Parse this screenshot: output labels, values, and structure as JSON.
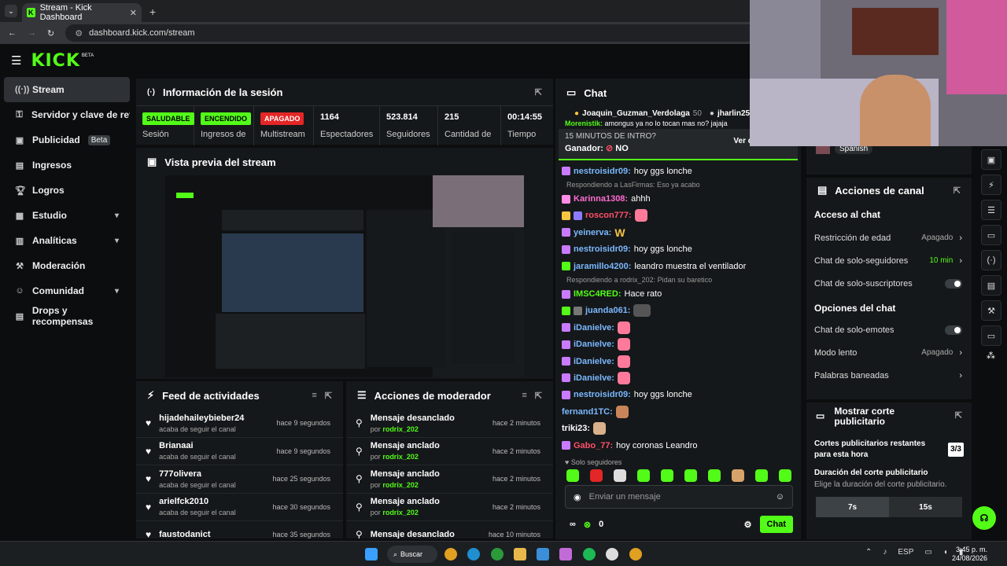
{
  "browser": {
    "tab_title": "Stream - Kick Dashboard",
    "url": "dashboard.kick.com/stream"
  },
  "brand": {
    "logo": "KICK",
    "tag": "BETA",
    "accent": "#53fc18"
  },
  "sidebar": {
    "items": [
      {
        "label": "Stream",
        "icon": "stream-icon"
      },
      {
        "label": "Servidor y clave de retransmisión",
        "icon": "key-icon"
      },
      {
        "label": "Publicidad",
        "badge": "Beta",
        "icon": "ad-icon"
      },
      {
        "label": "Ingresos",
        "icon": "revenue-icon"
      },
      {
        "label": "Logros",
        "icon": "trophy-icon"
      },
      {
        "label": "Estudio",
        "icon": "studio-icon"
      },
      {
        "label": "Analíticas",
        "icon": "chart-icon"
      },
      {
        "label": "Moderación",
        "icon": "hammer-icon"
      },
      {
        "label": "Comunidad",
        "icon": "community-icon"
      },
      {
        "label": "Drops y recompensas",
        "icon": "gift-icon"
      }
    ]
  },
  "session": {
    "title": "Información de la sesión",
    "stats": [
      {
        "pill": "SALUDABLE",
        "label": "Sesión"
      },
      {
        "pill": "ENCENDIDO",
        "label": "Ingresos de"
      },
      {
        "pill": "APAGADO",
        "label": "Multistream"
      },
      {
        "value": "1164",
        "label": "Espectadores"
      },
      {
        "value": "523.814",
        "label": "Seguidores"
      },
      {
        "value": "215",
        "label": "Cantidad de"
      },
      {
        "value": "00:14:55",
        "label": "Tiempo"
      }
    ]
  },
  "preview": {
    "title": "Vista previa del stream"
  },
  "feed": {
    "title": "Feed de actividades",
    "rows": [
      {
        "name": "hijadehaileybieber24",
        "sub": "acaba de seguir el canal",
        "time": "hace 9 segundos"
      },
      {
        "name": "Brianaai",
        "sub": "acaba de seguir el canal",
        "time": "hace 9 segundos"
      },
      {
        "name": "777olivera",
        "sub": "acaba de seguir el canal",
        "time": "hace 25 segundos"
      },
      {
        "name": "arielfck2010",
        "sub": "acaba de seguir el canal",
        "time": "hace 30 segundos"
      },
      {
        "name": "faustodanict",
        "sub": "",
        "time": "hace 35 segundos"
      }
    ]
  },
  "modactions": {
    "title": "Acciones de moderador",
    "rows": [
      {
        "name": "Mensaje desanclado",
        "by": "por ",
        "mod": "rodrix_202",
        "time": "hace 2 minutos"
      },
      {
        "name": "Mensaje anclado",
        "by": "por ",
        "mod": "rodrix_202",
        "time": "hace 2 minutos"
      },
      {
        "name": "Mensaje anclado",
        "by": "por ",
        "mod": "rodrix_202",
        "time": "hace 2 minutos"
      },
      {
        "name": "Mensaje anclado",
        "by": "por ",
        "mod": "rodrix_202",
        "time": "hace 2 minutos"
      },
      {
        "name": "Mensaje desanclado",
        "by": "",
        "mod": "",
        "time": "hace 10 minutos"
      }
    ]
  },
  "chat": {
    "title": "Chat",
    "pinned_users": [
      "Joaquin_Guzman_Verdolaga",
      "50",
      "jharlin25"
    ],
    "pinned_msg_user": "Morenistik:",
    "pinned_msg": "amongus ya no lo tocan mas no? jajaja",
    "poll_title": "15 MINUTOS DE INTRO?",
    "poll_winner_label": "Ganador:",
    "poll_winner": "NO",
    "poll_details": "Ver detalles",
    "messages": [
      {
        "user": "nestroisidr09:",
        "text": "hoy ggs lonche",
        "color": "#7ab8ff"
      },
      {
        "reply": "Respondiendo a LasFirmas: Eso ya acabo"
      },
      {
        "user": "Karinna1308:",
        "text": "ahhh",
        "color": "#ff6bd3"
      },
      {
        "user": "roscon777:",
        "text": "",
        "color": "#ff4f6a"
      },
      {
        "user": "yeinerva:",
        "text": "W",
        "color": "#7ab8ff"
      },
      {
        "user": "nestroisidr09:",
        "text": "hoy ggs lonche",
        "color": "#7ab8ff"
      },
      {
        "user": "jaramillo4200:",
        "text": "leandro muestra el ventilador",
        "color": "#7ab8ff"
      },
      {
        "reply": "Respondiendo a rodrix_202: Pidan su baretico"
      },
      {
        "user": "IMSC4RED:",
        "text": "Hace rato",
        "color": "#53fc18"
      },
      {
        "user": "juanda061:",
        "text": "",
        "color": "#7ab8ff"
      },
      {
        "user": "iDanielve:",
        "text": "",
        "color": "#7ab8ff"
      },
      {
        "user": "iDanielve:",
        "text": "",
        "color": "#7ab8ff"
      },
      {
        "user": "iDanielve:",
        "text": "",
        "color": "#7ab8ff"
      },
      {
        "user": "iDanielve:",
        "text": "",
        "color": "#7ab8ff"
      },
      {
        "user": "nestroisidr09:",
        "text": "hoy ggs lonche",
        "color": "#7ab8ff"
      },
      {
        "user": "fernand1TC:",
        "text": "",
        "color": "#7ab8ff"
      },
      {
        "user": "triki23:",
        "text": "",
        "color": "#ffffff"
      },
      {
        "user": "Gabo_77:",
        "text": "hoy coronas Leandro",
        "color": "#ff4f6a"
      }
    ],
    "mode": "Solo seguidores",
    "placeholder": "Enviar un mensaje",
    "count": "0",
    "send": "Chat"
  },
  "channel_actions": {
    "language": "Spanish",
    "title": "Acciones de canal",
    "sec1": "Acceso al chat",
    "rows1": [
      {
        "label": "Restricción de edad",
        "value": "Apagado"
      },
      {
        "label": "Chat de solo-seguidores",
        "value": "10 min"
      },
      {
        "label": "Chat de solo-suscriptores",
        "value": ""
      }
    ],
    "sec2": "Opciones del chat",
    "rows2": [
      {
        "label": "Chat de solo-emotes",
        "value": ""
      },
      {
        "label": "Modo lento",
        "value": "Apagado"
      },
      {
        "label": "Palabras baneadas",
        "value": ""
      }
    ]
  },
  "adbreak": {
    "title": "Mostrar corte publicitario",
    "remaining_label": "Cortes publicitarios restantes para esta hora",
    "remaining": "3/3",
    "duration_label": "Duración del corte publicitario",
    "duration_hint": "Elige la duración del corte publicitario.",
    "opt1": "7s",
    "opt2": "15s"
  },
  "taskbar": {
    "search": "Buscar",
    "lang": "ESP",
    "time": "3:45 p. m.",
    "date": "24/08/2026"
  }
}
